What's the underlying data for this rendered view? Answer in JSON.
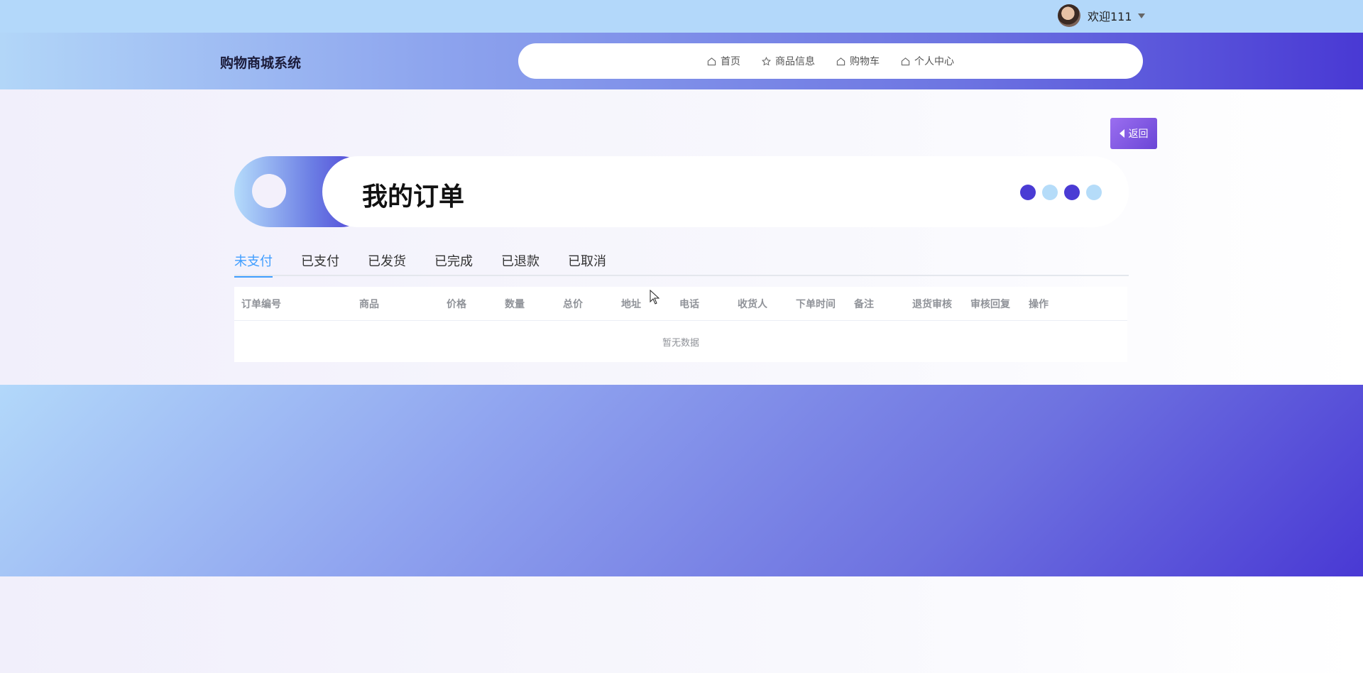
{
  "user": {
    "welcome": "欢迎111"
  },
  "header": {
    "brand": "购物商城系统",
    "nav": [
      {
        "label": "首页",
        "icon": "home-icon"
      },
      {
        "label": "商品信息",
        "icon": "star-icon"
      },
      {
        "label": "购物车",
        "icon": "home-icon"
      },
      {
        "label": "个人中心",
        "icon": "home-icon"
      }
    ]
  },
  "back_button": {
    "label": "返回"
  },
  "page": {
    "title": "我的订单",
    "dots": [
      "#4a3bd4",
      "#b5dcf9",
      "#4a3bd4",
      "#b5dcf9"
    ]
  },
  "tabs": [
    "未支付",
    "已支付",
    "已发货",
    "已完成",
    "已退款",
    "已取消"
  ],
  "table": {
    "columns": [
      "订单编号",
      "商品",
      "价格",
      "数量",
      "总价",
      "地址",
      "电话",
      "收货人",
      "下单时间",
      "备注",
      "退货审核",
      "审核回复",
      "操作"
    ],
    "empty_text": "暂无数据"
  }
}
